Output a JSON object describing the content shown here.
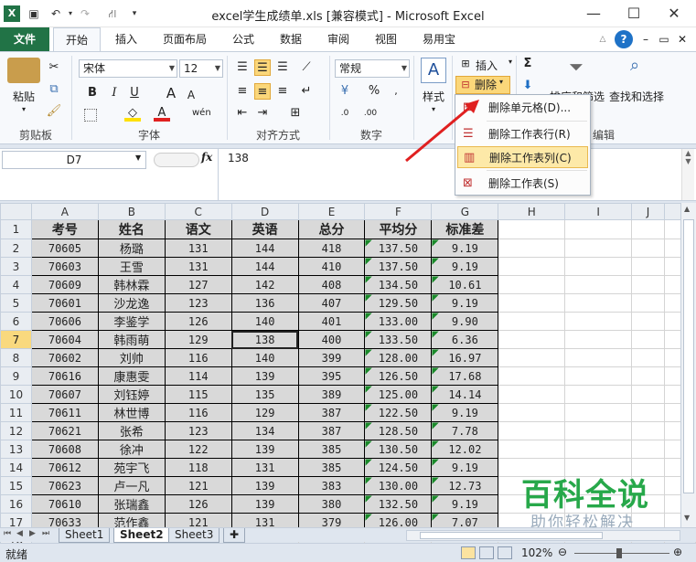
{
  "window": {
    "title": "excel学生成绩单.xls  [兼容模式] - Microsoft Excel"
  },
  "tabs": [
    "文件",
    "开始",
    "插入",
    "页面布局",
    "公式",
    "数据",
    "审阅",
    "视图",
    "易用宝"
  ],
  "ribbon": {
    "paste_label": "粘贴",
    "font_name": "宋体",
    "font_size": "12",
    "number_format": "常规",
    "styles_label": "样式",
    "insert_label": "插入",
    "delete_label": "删除",
    "sort_filter_label": "排序和筛选",
    "find_select_label": "查找和选择",
    "group_clipboard": "剪贴板",
    "group_font": "字体",
    "group_alignment": "对齐方式",
    "group_number": "数字",
    "group_edit": "编辑",
    "bold": "B",
    "italic": "I",
    "underline": "U",
    "grow": "A",
    "shrink": "A",
    "font_color": "A",
    "sum": "Σ"
  },
  "delete_menu": {
    "items": [
      "删除单元格(D)...",
      "删除工作表行(R)",
      "删除工作表列(C)",
      "删除工作表(S)"
    ]
  },
  "formula_bar": {
    "name_box": "D7",
    "fx": "fx",
    "value": "138"
  },
  "sheet": {
    "columns": [
      "A",
      "B",
      "C",
      "D",
      "E",
      "F",
      "G",
      "H",
      "I",
      "J"
    ],
    "selected_col": "D",
    "selected_row": 7,
    "header": [
      "考号",
      "姓名",
      "语文",
      "英语",
      "总分",
      "平均分",
      "标准差"
    ],
    "rows": [
      [
        "70605",
        "杨璐",
        "131",
        "144",
        "418",
        "137.50",
        "9.19"
      ],
      [
        "70603",
        "王雪",
        "131",
        "144",
        "410",
        "137.50",
        "9.19"
      ],
      [
        "70609",
        "韩林霖",
        "127",
        "142",
        "408",
        "134.50",
        "10.61"
      ],
      [
        "70601",
        "沙龙逸",
        "123",
        "136",
        "407",
        "129.50",
        "9.19"
      ],
      [
        "70606",
        "李鉴学",
        "126",
        "140",
        "401",
        "133.00",
        "9.90"
      ],
      [
        "70604",
        "韩雨萌",
        "129",
        "138",
        "400",
        "133.50",
        "6.36"
      ],
      [
        "70602",
        "刘帅",
        "116",
        "140",
        "399",
        "128.00",
        "16.97"
      ],
      [
        "70616",
        "康惠雯",
        "114",
        "139",
        "395",
        "126.50",
        "17.68"
      ],
      [
        "70607",
        "刘钰婷",
        "115",
        "135",
        "389",
        "125.00",
        "14.14"
      ],
      [
        "70611",
        "林世博",
        "116",
        "129",
        "387",
        "122.50",
        "9.19"
      ],
      [
        "70621",
        "张希",
        "123",
        "134",
        "387",
        "128.50",
        "7.78"
      ],
      [
        "70608",
        "徐冲",
        "122",
        "139",
        "385",
        "130.50",
        "12.02"
      ],
      [
        "70612",
        "苑宇飞",
        "118",
        "131",
        "385",
        "124.50",
        "9.19"
      ],
      [
        "70623",
        "卢一凡",
        "121",
        "139",
        "383",
        "130.00",
        "12.73"
      ],
      [
        "70610",
        "张瑞鑫",
        "126",
        "139",
        "380",
        "132.50",
        "9.19"
      ],
      [
        "70633",
        "范作鑫",
        "121",
        "131",
        "379",
        "126.00",
        "7.07"
      ]
    ],
    "extra_row": "18"
  },
  "sheet_tabs": [
    "Sheet1",
    "Sheet2",
    "Sheet3"
  ],
  "active_sheet": "Sheet2",
  "status": {
    "ready": "就绪",
    "zoom": "102%"
  },
  "watermark": {
    "line1": "百科全说",
    "line2": "助你轻松解决"
  },
  "colors": {
    "file_tab": "#217346",
    "selection_header": "#f9d97e",
    "data_fill": "#d9d9d9",
    "menu_highlight": "#fde9a8",
    "arrow": "#e02020",
    "watermark": "#27a84a"
  }
}
